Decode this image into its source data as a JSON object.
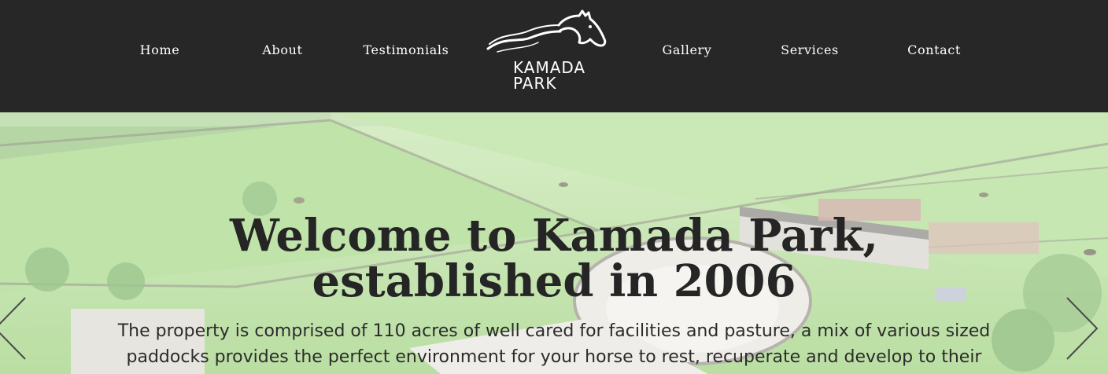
{
  "nav": {
    "items_left": [
      "Home",
      "About",
      "Testimonials"
    ],
    "items_right": [
      "Gallery",
      "Services",
      "Contact"
    ],
    "logo_line1": "KAMADA",
    "logo_line2": "PARK"
  },
  "hero": {
    "title": "Welcome to Kamada Park, established in 2006",
    "body": "The property is comprised of 110 acres of well cared for facilities and pasture, a mix of various sized paddocks provides the perfect environment for your horse to rest, recuperate and develop to their"
  },
  "icons": {
    "logo": "horse-head-icon",
    "prev": "chevron-left-icon",
    "next": "chevron-right-icon"
  },
  "colors": {
    "header_bg": "#272727",
    "nav_text": "#ffffff",
    "title_text": "#252525",
    "pasture": "#a7d88a"
  }
}
